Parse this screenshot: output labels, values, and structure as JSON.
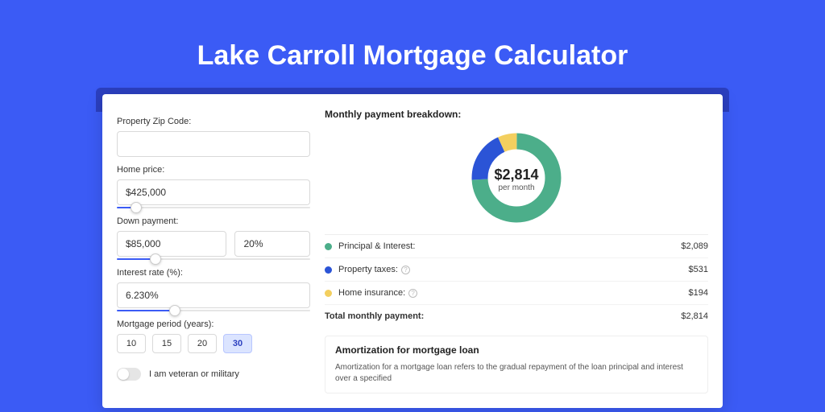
{
  "title": "Lake Carroll Mortgage Calculator",
  "form": {
    "zip_label": "Property Zip Code:",
    "zip_value": "",
    "home_price_label": "Home price:",
    "home_price_value": "$425,000",
    "down_payment_label": "Down payment:",
    "down_payment_value": "$85,000",
    "down_payment_pct": "20%",
    "interest_label": "Interest rate (%):",
    "interest_value": "6.230%",
    "period_label": "Mortgage period (years):",
    "periods": [
      "10",
      "15",
      "20",
      "30"
    ],
    "period_selected": "30",
    "veteran_label": "I am veteran or military"
  },
  "breakdown": {
    "title": "Monthly payment breakdown:",
    "center_amount": "$2,814",
    "center_sub": "per month",
    "items": [
      {
        "label": "Principal & Interest:",
        "value": "$2,089",
        "color": "green"
      },
      {
        "label": "Property taxes:",
        "value": "$531",
        "color": "blue",
        "help": true
      },
      {
        "label": "Home insurance:",
        "value": "$194",
        "color": "yellow",
        "help": true
      }
    ],
    "total_label": "Total monthly payment:",
    "total_value": "$2,814"
  },
  "amort": {
    "title": "Amortization for mortgage loan",
    "text": "Amortization for a mortgage loan refers to the gradual repayment of the loan principal and interest over a specified"
  },
  "chart_data": {
    "type": "pie",
    "title": "Monthly payment breakdown",
    "series": [
      {
        "name": "Principal & Interest",
        "value": 2089,
        "color": "#4cae8a"
      },
      {
        "name": "Property taxes",
        "value": 531,
        "color": "#2b54d6"
      },
      {
        "name": "Home insurance",
        "value": 194,
        "color": "#f3cf5f"
      }
    ],
    "total": 2814,
    "center_label": "$2,814 per month"
  }
}
